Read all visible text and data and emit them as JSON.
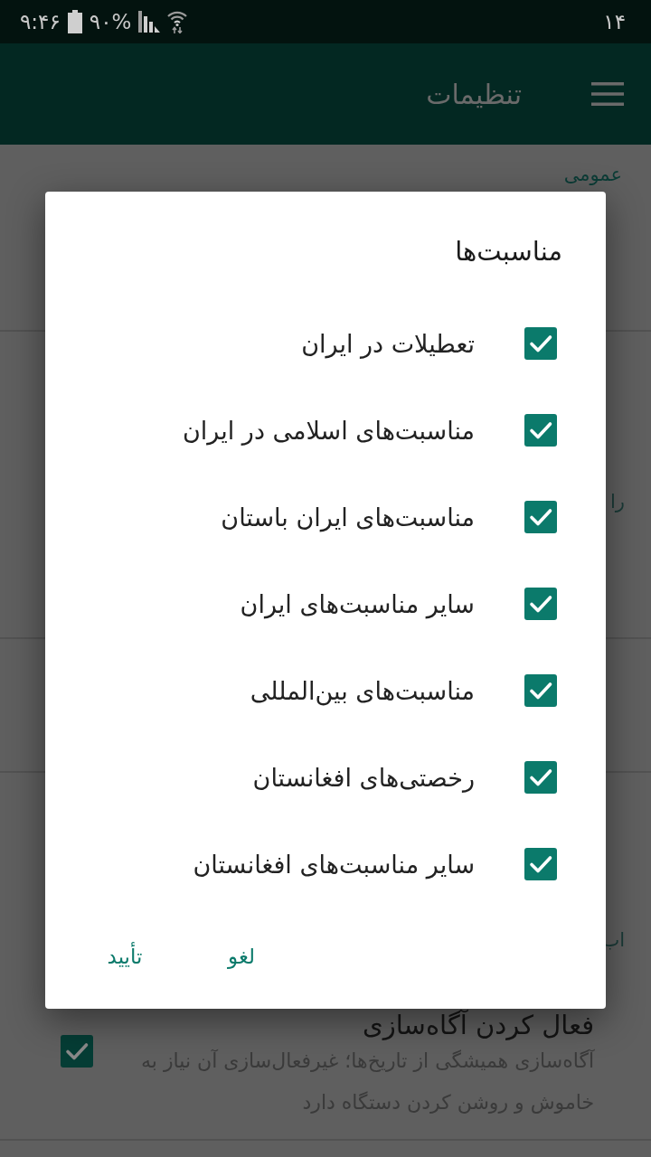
{
  "status_bar": {
    "time": "۹:۴۶",
    "battery": "۹۰%",
    "right_label": "۱۴"
  },
  "app_bar": {
    "title": "تنظیمات"
  },
  "settings": {
    "section_title": "عمومی",
    "cut_items": [
      {
        "title": "را"
      },
      {
        "title": "اب"
      }
    ],
    "notification_setting": {
      "title": "فعال کردن آگاه‌سازی",
      "checked": true,
      "summary": "آگاه‌سازی همیشگی از تاریخ‌ها؛ غیرفعال‌سازی آن نیاز به خاموش و روشن کردن دستگاه دارد"
    }
  },
  "dialog": {
    "title": "مناسبت‌ها",
    "options": [
      {
        "label": "تعطیلات در ایران",
        "checked": true
      },
      {
        "label": "مناسبت‌های اسلامی در ایران",
        "checked": true
      },
      {
        "label": "مناسبت‌های ایران باستان",
        "checked": true
      },
      {
        "label": "سایر مناسبت‌های ایران",
        "checked": true
      },
      {
        "label": "مناسبت‌های بین‌المللی",
        "checked": true
      },
      {
        "label": "رخصتی‌های افغانستان",
        "checked": true
      },
      {
        "label": "سایر مناسبت‌های افغانستان",
        "checked": true
      }
    ],
    "buttons": [
      {
        "label": "لغو"
      },
      {
        "label": "تأیید"
      }
    ]
  }
}
